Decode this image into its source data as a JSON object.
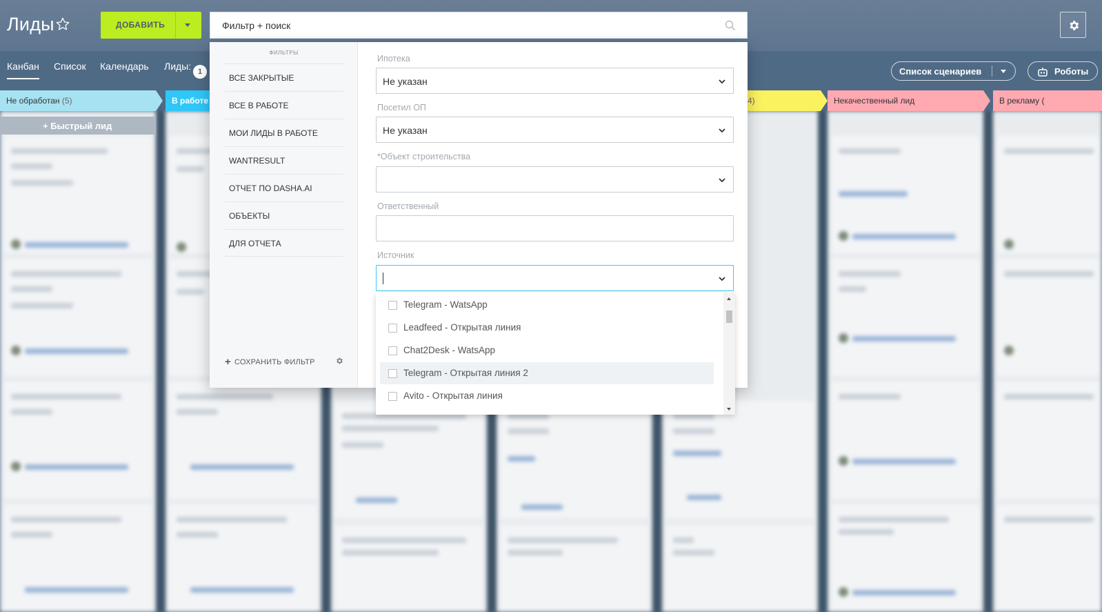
{
  "header": {
    "title": "Лиды",
    "add_label": "ДОБАВИТЬ",
    "search_text": "Фильтр + поиск"
  },
  "tabs": [
    {
      "label": "Канбан",
      "active": true
    },
    {
      "label": "Список",
      "active": false
    },
    {
      "label": "Календарь",
      "active": false
    },
    {
      "label": "Лиды:",
      "active": false
    }
  ],
  "leads_count": "1",
  "toolbar": {
    "scenarios_label": "Список сценариев",
    "robots_label": "Роботы"
  },
  "stages": [
    {
      "name": "Не обработан",
      "count": "(5)",
      "color": "#a7e2f2"
    },
    {
      "name": "В работе",
      "count": "",
      "color": "#2fc7f7"
    },
    {
      "name": "4)",
      "count": "",
      "color": "#fbf25f"
    },
    {
      "name": "Некачественный лид",
      "count": "",
      "color": "#ffa9b1"
    },
    {
      "name": "В рекламу (",
      "count": "",
      "color": "#ffa9b1"
    }
  ],
  "quick_lead_label": "Быстрый лид",
  "filter": {
    "presets_heading": "ФИЛЬТРЫ",
    "presets": [
      "ВСЕ ЗАКРЫТЫЕ",
      "ВСЕ В РАБОТЕ",
      "МОИ ЛИДЫ В РАБОТЕ",
      "WANTRESULT",
      "ОТЧЕТ ПО DASHA.AI",
      "ОБЪЕКТЫ",
      "ДЛЯ ОТЧЕТА"
    ],
    "save_label": "СОХРАНИТЬ ФИЛЬТР",
    "fields": [
      {
        "label": "Ипотека",
        "value": "Не указан"
      },
      {
        "label": "Посетил ОП",
        "value": "Не указан"
      },
      {
        "label": "*Объект строительства",
        "value": ""
      },
      {
        "label": "Ответственный",
        "value": ""
      },
      {
        "label": "Источник",
        "value": ""
      }
    ],
    "source_options": [
      {
        "label": "Telegram - WatsApp",
        "checked": false
      },
      {
        "label": "Leadfeed - Открытая линия",
        "checked": false
      },
      {
        "label": "Chat2Desk - WatsApp",
        "checked": false
      },
      {
        "label": "Telegram - Открытая линия 2",
        "checked": false,
        "hover": true
      },
      {
        "label": "Avito - Открытая линия",
        "checked": false
      }
    ]
  },
  "colors": {
    "header_bg": "#5e7590",
    "add_button": "#bbed21",
    "focus_border": "#3bc8f5"
  }
}
